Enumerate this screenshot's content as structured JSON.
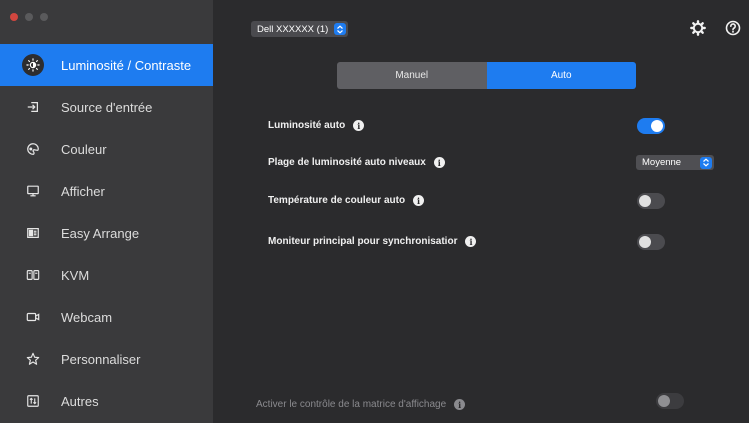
{
  "sidebar": {
    "items": [
      {
        "label": "Luminosité / Contraste",
        "icon": "brightness-icon",
        "active": true
      },
      {
        "label": "Source d'entrée",
        "icon": "input-source-icon"
      },
      {
        "label": "Couleur",
        "icon": "color-palette-icon"
      },
      {
        "label": "Afficher",
        "icon": "display-icon"
      },
      {
        "label": "Easy Arrange",
        "icon": "easy-arrange-icon"
      },
      {
        "label": "KVM",
        "icon": "kvm-icon"
      },
      {
        "label": "Webcam",
        "icon": "webcam-icon"
      },
      {
        "label": "Personnaliser",
        "icon": "star-icon"
      },
      {
        "label": "Autres",
        "icon": "others-icon"
      }
    ]
  },
  "header": {
    "monitor": "Dell XXXXXX (1)"
  },
  "mode": {
    "options": [
      "Manuel",
      "Auto"
    ],
    "selected": "Auto"
  },
  "settings": {
    "auto_brightness": {
      "label": "Luminosité auto",
      "on": true
    },
    "auto_brightness_range": {
      "label": "Plage de luminosité auto niveaux",
      "value": "Moyenne"
    },
    "auto_color_temp": {
      "label": "Température de couleur auto",
      "on": false
    },
    "sync_main_monitor": {
      "label": "Moniteur principal pour synchronisatior",
      "on": false
    },
    "matrix_control": {
      "label": "Activer le contrôle de la matrice d'affichage",
      "on": false,
      "enabled": false
    }
  },
  "colors": {
    "accent": "#1e7cf0",
    "sidebar_bg": "#3a3a3c",
    "content_bg": "#2b2b2d"
  }
}
